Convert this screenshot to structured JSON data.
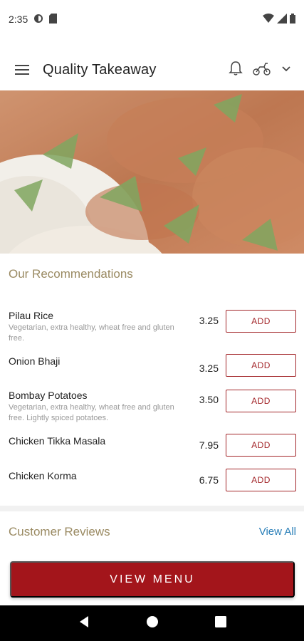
{
  "status_bar": {
    "time": "2:35",
    "icons": [
      "sync-icon",
      "sim-card-icon",
      "wifi-icon",
      "signal-icon",
      "battery-icon"
    ]
  },
  "app_bar": {
    "title": "Quality Takeaway",
    "icons": [
      "menu-icon",
      "bell-icon",
      "delivery-scooter-icon",
      "chevron-down-icon"
    ]
  },
  "hero": {
    "alt": "food-image"
  },
  "recommendations": {
    "title": "Our Recommendations",
    "add_label": "ADD",
    "items": [
      {
        "name": "Pilau Rice",
        "description": "Vegetarian, extra healthy, wheat free and gluten free.",
        "price": "3.25"
      },
      {
        "name": "Onion Bhaji",
        "description": "",
        "price": "3.25"
      },
      {
        "name": "Bombay Potatoes",
        "description": "Vegetarian, extra healthy, wheat free and gluten free. Lightly spiced potatoes.",
        "price": "3.50"
      },
      {
        "name": "Chicken Tikka Masala",
        "description": "",
        "price": "7.95"
      },
      {
        "name": "Chicken Korma",
        "description": "",
        "price": "6.75"
      }
    ]
  },
  "reviews": {
    "title": "Customer Reviews",
    "view_all": "View All"
  },
  "cta": {
    "label": "VIEW MENU"
  },
  "colors": {
    "accent": "#a3151b",
    "section_title": "#9a8a62",
    "link": "#2a7fb8"
  }
}
